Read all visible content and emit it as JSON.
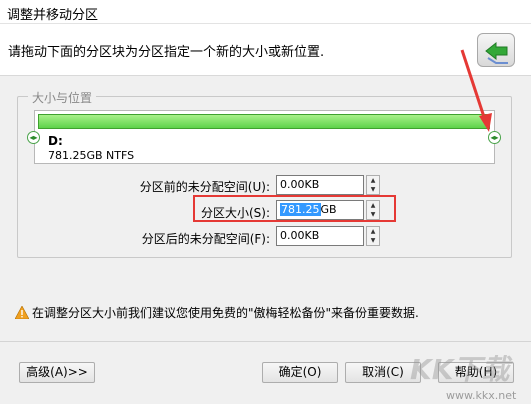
{
  "window": {
    "title": "调整并移动分区"
  },
  "header": {
    "instruction": "请拖动下面的分区块为分区指定一个新的大小或新位置.",
    "back_icon": "back-arrow-icon"
  },
  "group": {
    "legend": "大小与位置"
  },
  "partition": {
    "name": "D:",
    "info": "781.25GB NTFS",
    "bar_color": "#5ed34b",
    "fill_fraction": 1.0
  },
  "fields": {
    "before_label": "分区前的未分配空间(U):",
    "before_value": "0.00KB",
    "size_label": "分区大小(S):",
    "size_value_selected": "781.25",
    "size_value_unit": "GB",
    "after_label": "分区后的未分配空间(F):",
    "after_value": "0.00KB"
  },
  "warning": {
    "text": "在调整分区大小前我们建议您使用免费的\"傲梅轻松备份\"来备份重要数据.",
    "icon": "warning-icon"
  },
  "buttons": {
    "advanced": "高级(A)>>",
    "ok": "确定(O)",
    "cancel": "取消(C)",
    "help": "帮助(H)"
  },
  "annotation": {
    "highlight_color": "#e53935"
  },
  "watermark": {
    "text": "KK下载",
    "url": "www.kkx.net"
  }
}
